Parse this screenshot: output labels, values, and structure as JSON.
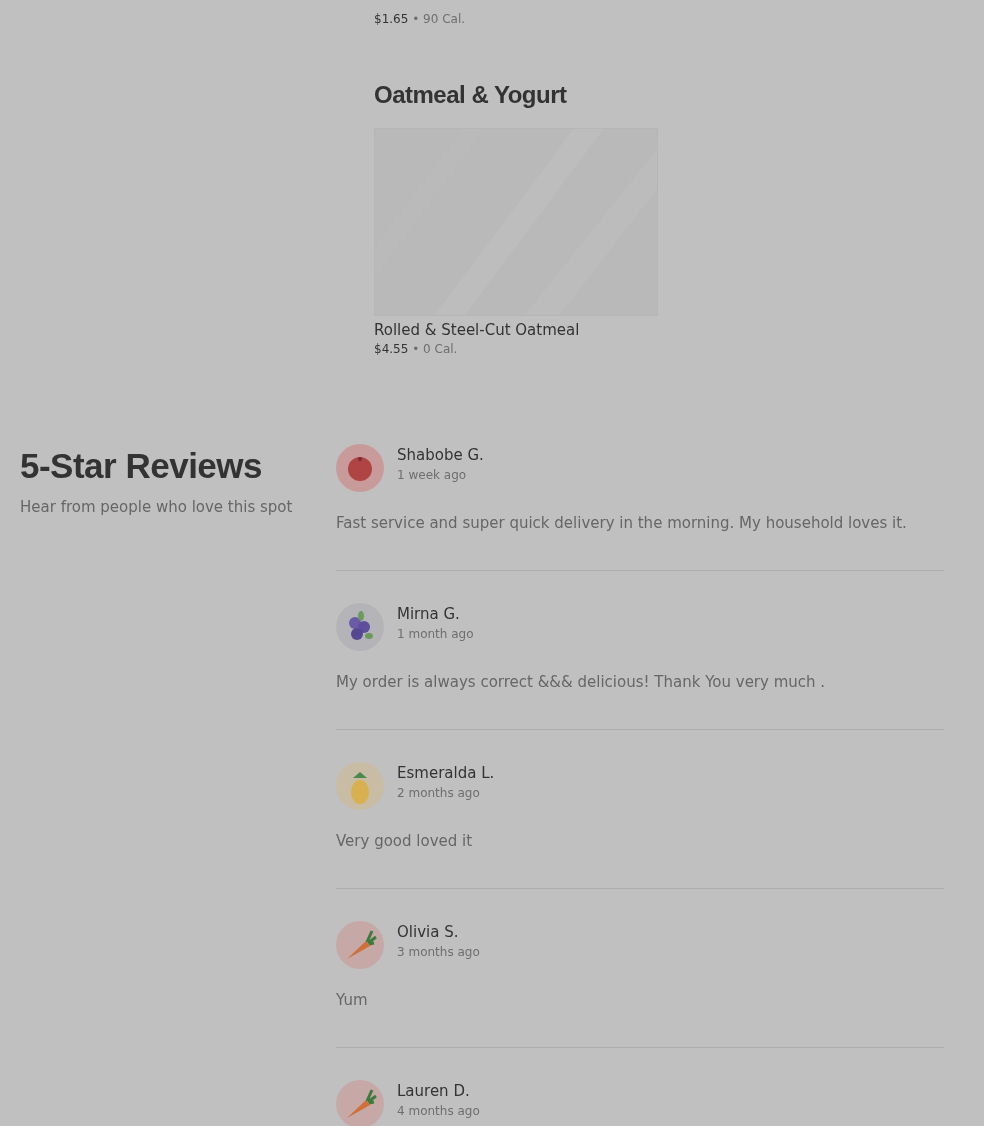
{
  "menu": {
    "previous_item": {
      "price": "$1.65",
      "calories": "• 90 Cal."
    },
    "section": {
      "title": "Oatmeal & Yogurt",
      "items": [
        {
          "kind": "picture",
          "name": "Rolled & Steel-Cut Oatmeal",
          "price": "$4.55",
          "calories": "• 0 Cal."
        }
      ]
    }
  },
  "reviews": {
    "title": "5-Star Reviews",
    "subtitle": "Hear from people who love this spot",
    "items": [
      {
        "name": "Shabobe G.",
        "time": "1 week ago",
        "kind": "tomato",
        "text": "Fast service and super quick delivery in the morning. My household loves it."
      },
      {
        "name": "Mirna G.",
        "time": "1 month ago",
        "kind": "blueberry",
        "text": "My order is always correct &&& delicious! Thank You very much ."
      },
      {
        "name": "Esmeralda L.",
        "time": "2 months ago",
        "kind": "pineapple",
        "text": "Very good loved it"
      },
      {
        "name": "Olivia S.",
        "time": "3 months ago",
        "kind": "carrot",
        "text": "Yum"
      },
      {
        "name": "Lauren D.",
        "time": "4 months ago",
        "kind": "carrot"
      }
    ]
  }
}
